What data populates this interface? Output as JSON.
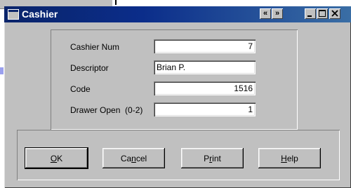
{
  "window": {
    "title": "Cashier",
    "title_icon": "window-icon",
    "controls": {
      "prev": "«",
      "next": "»",
      "minimize_icon": "minimize-icon",
      "maximize_icon": "maximize-icon",
      "close_icon": "close-icon"
    }
  },
  "fields": [
    {
      "label": "Cashier Num",
      "value": "7"
    },
    {
      "label": "Descriptor",
      "value": "Brian P."
    },
    {
      "label": "Code",
      "value": "1516"
    },
    {
      "label": "Drawer Open  (0-2)",
      "value": "1"
    }
  ],
  "buttons": {
    "ok": {
      "mnemonic": "O",
      "rest": "K"
    },
    "cancel": {
      "pre": "Ca",
      "mnemonic": "n",
      "rest": "cel"
    },
    "print": {
      "pre": "P",
      "mnemonic": "r",
      "rest": "int"
    },
    "help": {
      "mnemonic": "H",
      "rest": "elp"
    }
  },
  "colors": {
    "titlebar_start": "#0a246a",
    "titlebar_end": "#3a6ea5",
    "face": "#c0c0c0"
  }
}
